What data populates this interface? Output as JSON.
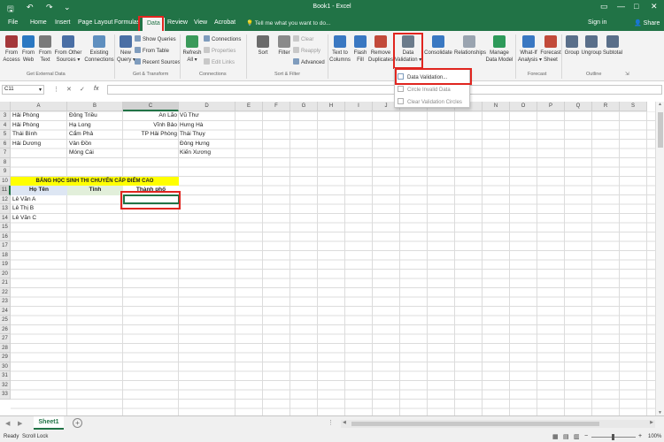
{
  "window": {
    "title": "Book1 - Excel",
    "help_placeholder": "Tell me what you want to do...",
    "sign_in": "Sign in",
    "share": "Share"
  },
  "tabs": [
    "File",
    "Home",
    "Insert",
    "Page Layout",
    "Formulas",
    "Data",
    "Review",
    "View",
    "Acrobat"
  ],
  "ribbon": {
    "buttons": [
      {
        "name": "from-access-button",
        "label": "From\nAccess",
        "color": "#a4373a"
      },
      {
        "name": "from-web-button",
        "label": "From\nWeb",
        "color": "#2b78c2"
      },
      {
        "name": "from-text-button",
        "label": "From\nText",
        "color": "#7a7a7a"
      },
      {
        "name": "from-other-sources-button",
        "label": "From Other\nSources ▾",
        "color": "#4a6fa5"
      },
      {
        "name": "existing-connections-button",
        "label": "Existing\nConnections",
        "color": "#5f8fbf"
      },
      {
        "name": "new-query-button",
        "label": "New\nQuery ▾",
        "color": "#4a6fa5"
      },
      {
        "name": "refresh-all-button",
        "label": "Refresh\nAll ▾",
        "color": "#3a9a5a"
      },
      {
        "name": "sort-button",
        "label": "Sort",
        "color": "#6b6b6b"
      },
      {
        "name": "filter-button",
        "label": "Filter",
        "color": "#8a8a8a"
      },
      {
        "name": "text-to-columns-button",
        "label": "Text to\nColumns",
        "color": "#3a78c2"
      },
      {
        "name": "flash-fill-button",
        "label": "Flash\nFill",
        "color": "#3a78c2"
      },
      {
        "name": "remove-duplicates-button",
        "label": "Remove\nDuplicates",
        "color": "#c24a3a"
      },
      {
        "name": "data-validation-button",
        "label": "Data\nValidation ▾",
        "color": "#6b7b8b"
      },
      {
        "name": "consolidate-button",
        "label": "Consolidate",
        "color": "#3a78c2"
      },
      {
        "name": "relationships-button",
        "label": "Relationships",
        "color": "#9aa4b0"
      },
      {
        "name": "manage-data-model-button",
        "label": "Manage\nData Model",
        "color": "#2e9a5a"
      },
      {
        "name": "what-if-analysis-button",
        "label": "What-If\nAnalysis ▾",
        "color": "#3a78c2"
      },
      {
        "name": "forecast-sheet-button",
        "label": "Forecast\nSheet",
        "color": "#c24a3a"
      },
      {
        "name": "group-button",
        "label": "Group",
        "color": "#5a6f8a"
      },
      {
        "name": "ungroup-button",
        "label": "Ungroup",
        "color": "#5a6f8a"
      },
      {
        "name": "subtotal-button",
        "label": "Subtotal",
        "color": "#5a6f8a"
      }
    ],
    "small": {
      "show_queries": "Show Queries",
      "from_table": "From Table",
      "recent_sources": "Recent Sources",
      "connections": "Connections",
      "properties": "Properties",
      "edit_links": "Edit Links",
      "clear": "Clear",
      "reapply": "Reapply",
      "advanced": "Advanced"
    },
    "groups": {
      "get_external_data": "Get External Data",
      "get_transform": "Get & Transform",
      "connections": "Connections",
      "sort_filter": "Sort & Filter",
      "forecast": "Forecast",
      "outline": "Outline"
    }
  },
  "formula_bar": {
    "name_box": "C11",
    "fx": "fx"
  },
  "columns": [
    "A",
    "B",
    "C",
    "D",
    "E",
    "F",
    "G",
    "H",
    "I",
    "J",
    "K",
    "L",
    "M",
    "N",
    "O",
    "P",
    "Q",
    "R",
    "S"
  ],
  "rows": [
    "3",
    "4",
    "5",
    "6",
    "7",
    "8",
    "9",
    "10",
    "11",
    "12",
    "13",
    "14",
    "15",
    "16",
    "17",
    "18",
    "19",
    "20",
    "21",
    "22",
    "23",
    "24",
    "25",
    "26",
    "27",
    "28",
    "29",
    "30",
    "31",
    "32",
    "33"
  ],
  "cells": {
    "a3": "Hải Phòng",
    "b3": "Đông Triều",
    "c3": "An Lão",
    "d3": "Vũ Thư",
    "a4": "Hải Phòng",
    "b4": "Hạ Long",
    "c4": "Vĩnh Bảo",
    "d4": "Hưng Hà",
    "a5": "Thái Bình",
    "b5": "Cẩm Phả",
    "c5": "TP Hải Phòng",
    "d5": "Thái Thụy",
    "a6": "Hải Dương",
    "b6": "Vân Đồn",
    "d6": "Đông Hưng",
    "b7": "Móng Cái",
    "d7": "Kiến Xương",
    "title": "BẢNG HỌC SINH THI CHUYỂN CẤP ĐIỂM CAO",
    "hdr_name": "Họ Tên",
    "hdr_province": "Tỉnh",
    "hdr_city": "Thành phố",
    "a11": "Lê Văn A",
    "a12": "Lê Thị B",
    "a13": "Lê Văn C"
  },
  "dropdown": {
    "data_validation": "Data Validation...",
    "circle_invalid": "Circle Invalid Data",
    "clear_circles": "Clear Validation Circles"
  },
  "sheet_tab": "Sheet1",
  "status": {
    "ready": "Ready",
    "scroll_lock": "Scroll Lock",
    "zoom": "100%"
  },
  "colors": {
    "excel_green": "#217346",
    "highlight_red": "#e0251f",
    "title_fill": "#ffff00",
    "header_fill": "#dde6f3"
  }
}
